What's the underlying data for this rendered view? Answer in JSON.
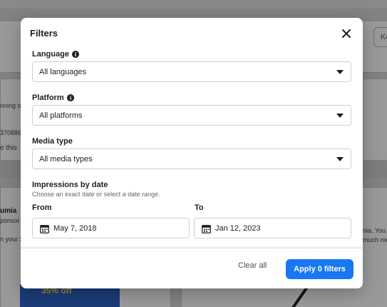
{
  "background": {
    "search_hint": "Ke",
    "left_card": {
      "line1": "nning o",
      "line2": "370886",
      "line3": "e this"
    },
    "bottom_left_card": {
      "title": "umia",
      "subtitle": "ponsor",
      "line": "n your S"
    },
    "bottom_right_card": {
      "line1": "nia. You a",
      "line2": "much me"
    },
    "promo": "35% off"
  },
  "modal": {
    "title": "Filters",
    "language": {
      "label": "Language",
      "value": "All languages"
    },
    "platform": {
      "label": "Platform",
      "value": "All platforms"
    },
    "media_type": {
      "label": "Media type",
      "value": "All media types"
    },
    "impressions": {
      "label": "Impressions by date",
      "hint": "Choose an exact date or select a date range.",
      "from_label": "From",
      "from_value": "May 7, 2018",
      "to_label": "To",
      "to_value": "Jan 12, 2023"
    },
    "footer": {
      "clear_label": "Clear all",
      "apply_label": "Apply 0 filters"
    }
  },
  "colors": {
    "primary": "#1877f2",
    "overlay": "rgba(0,0,0,0.40)"
  }
}
